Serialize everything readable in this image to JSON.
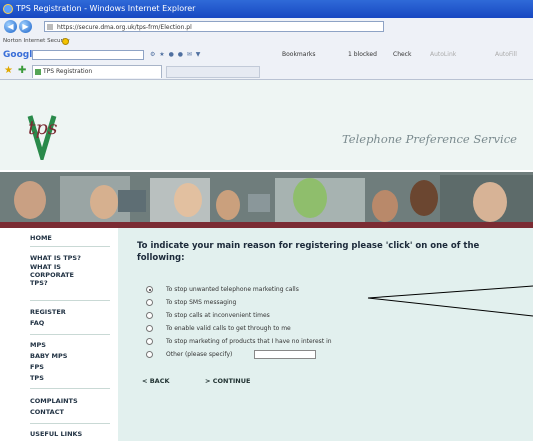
{
  "window": {
    "title": "TPS Registration - Windows Internet Explorer"
  },
  "address": {
    "url": "https://secure.dma.org.uk/tps-frm/Election.pl"
  },
  "security": {
    "label": "Norton Internet Security"
  },
  "google_toolbar": {
    "logo": "Google",
    "search_placeholder": "",
    "bookmarks_label": "Bookmarks",
    "blocked_label": "1 blocked",
    "check_label": "Check",
    "autolink_label": "AutoLink",
    "autofill_label": "AutoFill"
  },
  "tab": {
    "label": "TPS Registration"
  },
  "site": {
    "logo_text": "tps",
    "title": "Telephone Preference Service"
  },
  "sidebar": {
    "items": [
      {
        "label": "HOME"
      },
      {
        "label": "WHAT IS TPS?"
      },
      {
        "label": "WHAT IS CORPORATE TPS?"
      },
      {
        "label": "REGISTER"
      },
      {
        "label": "FAQ"
      },
      {
        "label": "MPS"
      },
      {
        "label": "BABY MPS"
      },
      {
        "label": "FPS"
      },
      {
        "label": "TPS"
      },
      {
        "label": "COMPLAINTS"
      },
      {
        "label": "CONTACT"
      },
      {
        "label": "USEFUL LINKS"
      }
    ]
  },
  "form": {
    "heading": "To indicate your main reason for registering please 'click' on one of the following:",
    "options": [
      {
        "label": "To stop unwanted telephone marketing calls",
        "selected": true
      },
      {
        "label": "To stop SMS messaging",
        "selected": false
      },
      {
        "label": "To stop calls at inconvenient times",
        "selected": false
      },
      {
        "label": "To enable valid calls to get through to me",
        "selected": false
      },
      {
        "label": "To stop marketing of products that I have no interest in",
        "selected": false
      },
      {
        "label": "Other (please specify)",
        "selected": false
      }
    ],
    "other_value": "",
    "back_label": "< BACK",
    "continue_label": "> CONTINUE"
  },
  "colors": {
    "content_bg": "#e2f0ee",
    "banner_stripe": "#7b2b33",
    "titlebar": "#1f55cc"
  }
}
